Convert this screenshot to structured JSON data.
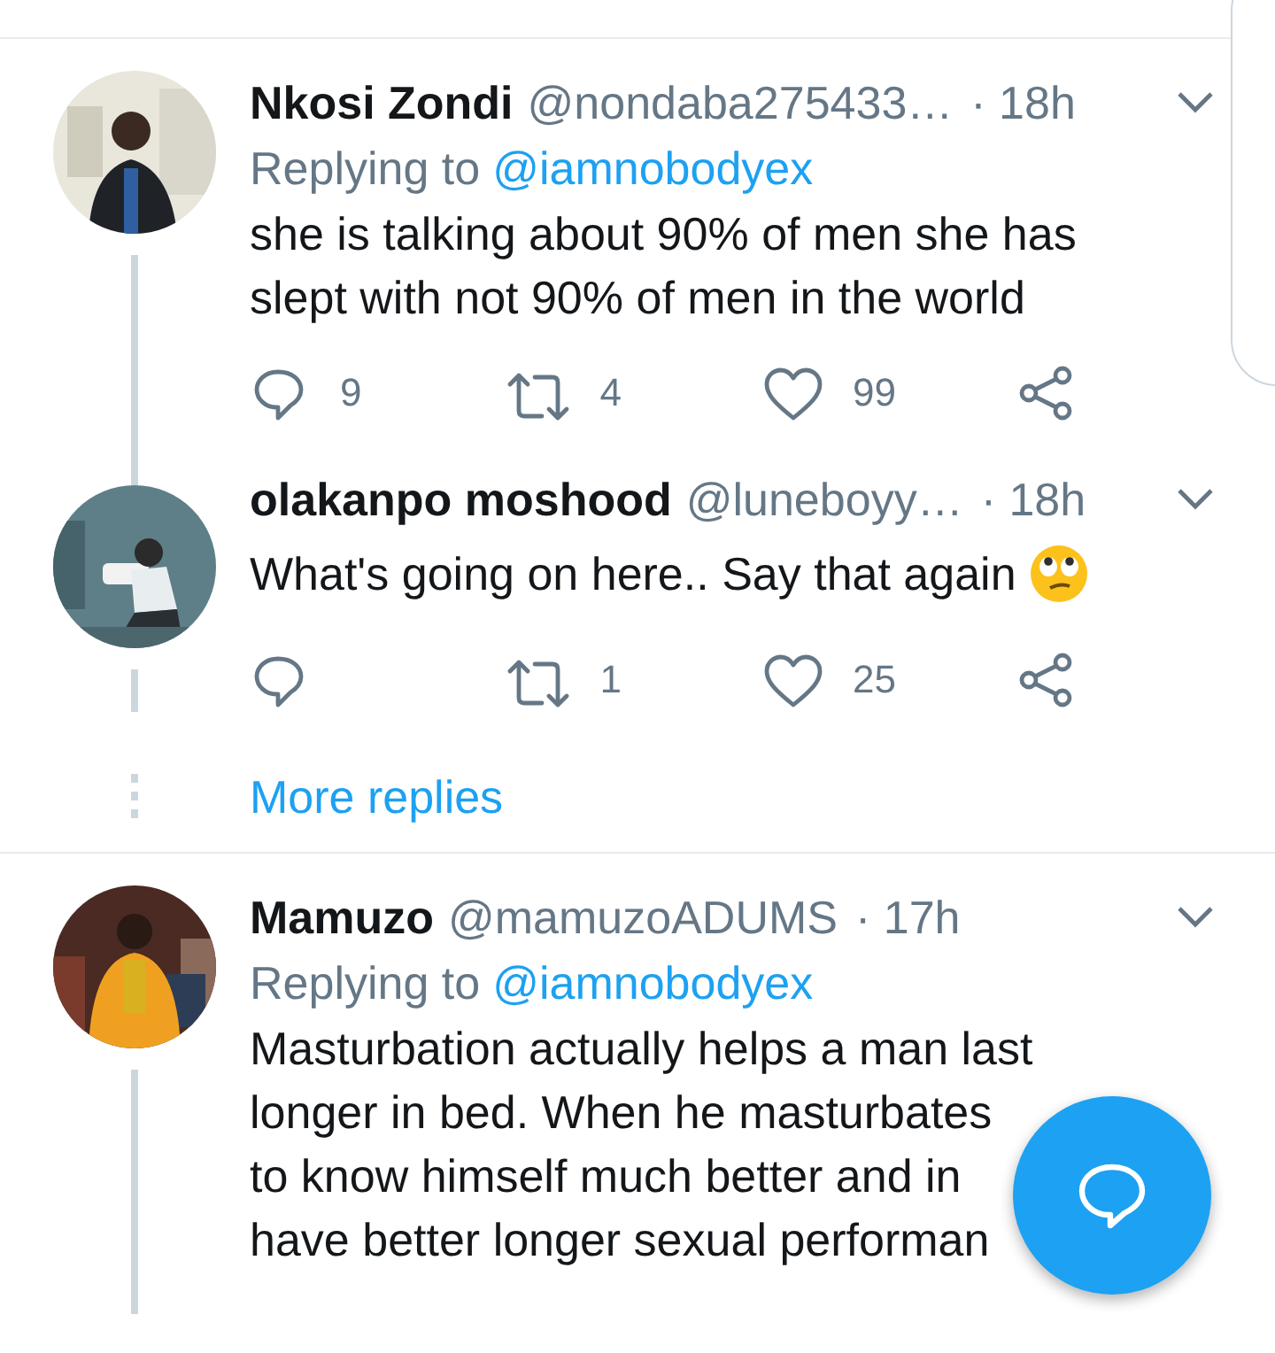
{
  "tweets": [
    {
      "name": "Nkosi Zondi",
      "handle": "@nondaba275433…",
      "time": "· 18h",
      "replying_to": {
        "label": "Replying to",
        "handle": "@iamnobodyex"
      },
      "lines": [
        "she is talking about 90% of men she has",
        "slept with not 90% of men in the world"
      ],
      "actions": [
        {
          "kind": "reply",
          "count": "9"
        },
        {
          "kind": "retweet",
          "count": "4"
        },
        {
          "kind": "like",
          "count": "99"
        },
        {
          "kind": "share"
        }
      ]
    },
    {
      "name": "olakanpo moshood",
      "handle": "@luneboyy…",
      "time": "· 18h",
      "lines": [
        "What's going on here.. Say that again"
      ],
      "emoji": true,
      "actions": [
        {
          "kind": "reply"
        },
        {
          "kind": "retweet",
          "count": "1"
        },
        {
          "kind": "like",
          "count": "25"
        },
        {
          "kind": "share"
        }
      ],
      "more_replies": "More replies"
    },
    {
      "name": "Mamuzo",
      "handle": "@mamuzoADUMS",
      "time": "· 17h",
      "replying_to": {
        "label": "Replying to",
        "handle": "@iamnobodyex"
      },
      "lines": [
        "Masturbation actually helps a man last",
        "longer in bed. When he masturbates",
        "to know himself much better and in",
        "have better longer sexual performan"
      ]
    }
  ]
}
